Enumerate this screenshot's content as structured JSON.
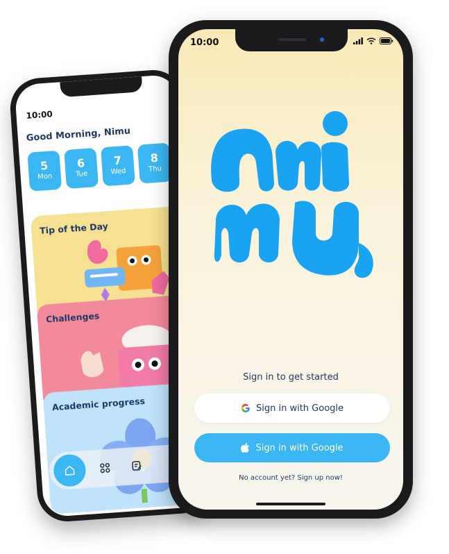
{
  "back_phone": {
    "status": {
      "time": "10:00"
    },
    "greeting": "Good Morning, Nimu",
    "days": [
      {
        "num": "5",
        "name": "Mon"
      },
      {
        "num": "6",
        "name": "Tue"
      },
      {
        "num": "7",
        "name": "Wed"
      },
      {
        "num": "8",
        "name": "Thu"
      }
    ],
    "cards": {
      "tip": "Tip of the Day",
      "challenges": "Challenges",
      "progress": "Academic progress"
    },
    "nav": [
      "home-icon",
      "grid-icon",
      "journal-icon"
    ]
  },
  "front_phone": {
    "status": {
      "time": "10:00"
    },
    "logo_text": "nimu",
    "caption": "Sign in to get started",
    "google_button": "Sign in with Google",
    "apple_button": "Sign in with Google",
    "signup_link": "No account yet? Sign up now!",
    "colors": {
      "accent": "#3ab6f3",
      "logo": "#1aa3f0",
      "text": "#1f3a68"
    }
  }
}
